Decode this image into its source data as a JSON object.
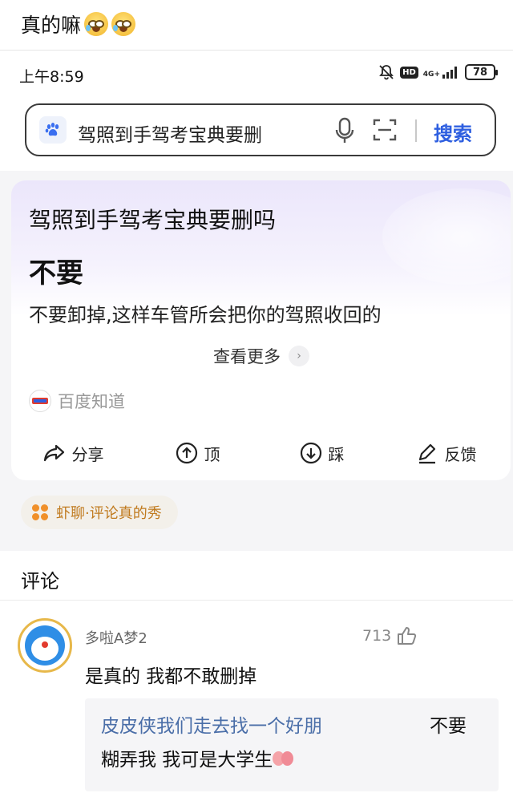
{
  "post": {
    "title": "真的嘛"
  },
  "status_bar": {
    "time": "上午8:59",
    "network": "4G+",
    "hd": "HD",
    "battery": "78"
  },
  "search": {
    "query": "驾照到手驾考宝典要删",
    "button_label": "搜索"
  },
  "answer_card": {
    "question": "驾照到手驾考宝典要删吗",
    "answer": "不要",
    "detail": "不要卸掉,这样车管所会把你的驾照收回的",
    "more_label": "查看更多",
    "source": "百度知道",
    "actions": [
      {
        "label": "分享",
        "icon": "share-icon"
      },
      {
        "label": "顶",
        "icon": "upvote-icon"
      },
      {
        "label": "踩",
        "icon": "downvote-icon"
      },
      {
        "label": "反馈",
        "icon": "edit-icon"
      }
    ]
  },
  "tag": {
    "label": "虾聊·评论真的秀"
  },
  "comments": {
    "title": "评论",
    "items": [
      {
        "user": "多啦A梦2",
        "likes": "713",
        "text": "是真的 我都不敢删掉",
        "reply": {
          "user": "皮皮侠我们走去找一个好朋",
          "text_inline": "不要",
          "text_line2": "糊弄我 我可是大学生"
        }
      }
    ]
  },
  "colors": {
    "accent": "#2e5fe0",
    "tag_text": "#c07a1e",
    "reply_user": "#4a6ea8"
  }
}
